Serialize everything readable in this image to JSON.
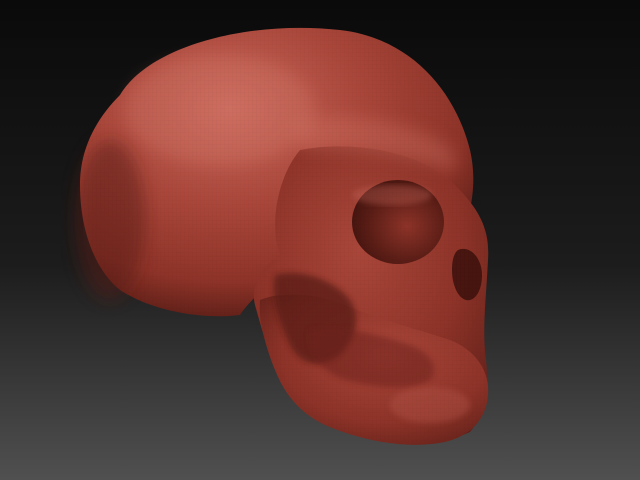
{
  "scene": {
    "subject": "skull-sculpt",
    "colors": {
      "bg_top": "#0a0a0a",
      "bg_mid": "#1c1c1c",
      "bg_bottom": "#505050",
      "material_light": "#c9675a",
      "material_base": "#a9463a",
      "material_mid": "#8e3328",
      "material_shadow": "#5a1d16",
      "material_deep": "#3c110c"
    }
  }
}
